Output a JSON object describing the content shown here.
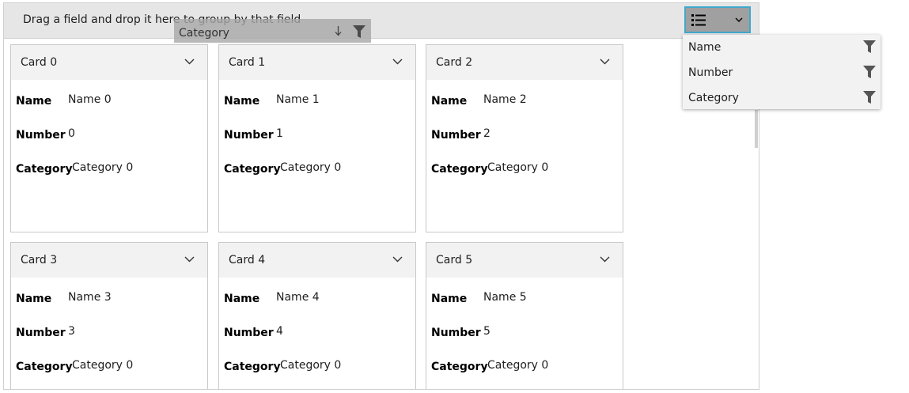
{
  "group_panel": {
    "hint": "Drag a field and drop it here to group by that field"
  },
  "drag_ghost": {
    "label": "Category"
  },
  "view_button": {
    "icon": "list-icon"
  },
  "cards": [
    {
      "title": "Card 0",
      "name": "Name 0",
      "number": "0",
      "category": "Category 0"
    },
    {
      "title": "Card 1",
      "name": "Name 1",
      "number": "1",
      "category": "Category 0"
    },
    {
      "title": "Card 2",
      "name": "Name 2",
      "number": "2",
      "category": "Category 0"
    },
    {
      "title": "Card 3",
      "name": "Name 3",
      "number": "3",
      "category": "Category 0"
    },
    {
      "title": "Card 4",
      "name": "Name 4",
      "number": "4",
      "category": "Category 0"
    },
    {
      "title": "Card 5",
      "name": "Name 5",
      "number": "5",
      "category": "Category 0"
    }
  ],
  "field_labels": {
    "name": "Name",
    "number": "Number",
    "category": "Category"
  },
  "dropdown": {
    "items": [
      {
        "label": "Name"
      },
      {
        "label": "Number"
      },
      {
        "label": "Category"
      }
    ]
  },
  "colors": {
    "accent_border": "#40a8cc",
    "header_bg": "#e6e6e6",
    "card_head_bg": "#f2f2f2"
  }
}
